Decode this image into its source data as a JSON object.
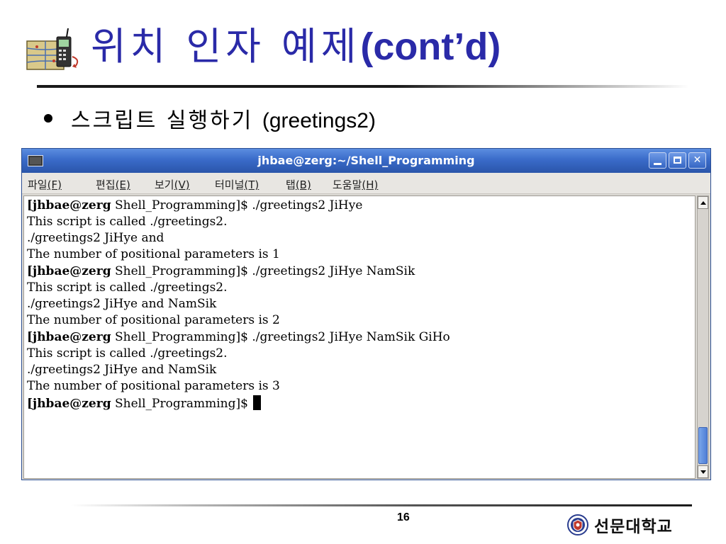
{
  "slide": {
    "title_ko": "위치 인자 예제",
    "title_en": "(cont’d)",
    "bullet_ko": "스크립트 실행하기 ",
    "bullet_en": "(greetings2)",
    "page_number": "16",
    "university_name": "선문대학교"
  },
  "icons": {
    "title_icon": "phone-network-icon",
    "logo": "university-seal-icon"
  },
  "colors": {
    "title": "#2a2aa8",
    "titlebar": "#3a6bc9",
    "scroll_thumb": "#5a8ae0"
  },
  "terminal": {
    "window_title": "jhbae@zerg:~/Shell_Programming",
    "menu": [
      {
        "label": "파일",
        "mnemonic": "(F)"
      },
      {
        "label": "편집",
        "mnemonic": "(E)"
      },
      {
        "label": "보기",
        "mnemonic": "(V)"
      },
      {
        "label": "터미널",
        "mnemonic": "(T)"
      },
      {
        "label": "탭",
        "mnemonic": "(B)"
      },
      {
        "label": "도움말",
        "mnemonic": "(H)"
      }
    ],
    "lines": [
      {
        "host": "[jhbae@zerg",
        "rest": " Shell_Programming]$ ./greetings2 JiHye"
      },
      {
        "text": "This script is called ./greetings2."
      },
      {
        "text": "./greetings2 JiHye and"
      },
      {
        "text": "The number of positional parameters is 1"
      },
      {
        "host": "[jhbae@zerg",
        "rest": " Shell_Programming]$ ./greetings2 JiHye NamSik"
      },
      {
        "text": "This script is called ./greetings2."
      },
      {
        "text": "./greetings2 JiHye and NamSik"
      },
      {
        "text": "The number of positional parameters is 2"
      },
      {
        "host": "[jhbae@zerg",
        "rest": " Shell_Programming]$ ./greetings2 JiHye NamSik GiHo"
      },
      {
        "text": "This script is called ./greetings2."
      },
      {
        "text": "./greetings2 JiHye and NamSik"
      },
      {
        "text": "The number of positional parameters is 3"
      },
      {
        "host": "[jhbae@zerg",
        "rest": " Shell_Programming]$ "
      }
    ]
  }
}
